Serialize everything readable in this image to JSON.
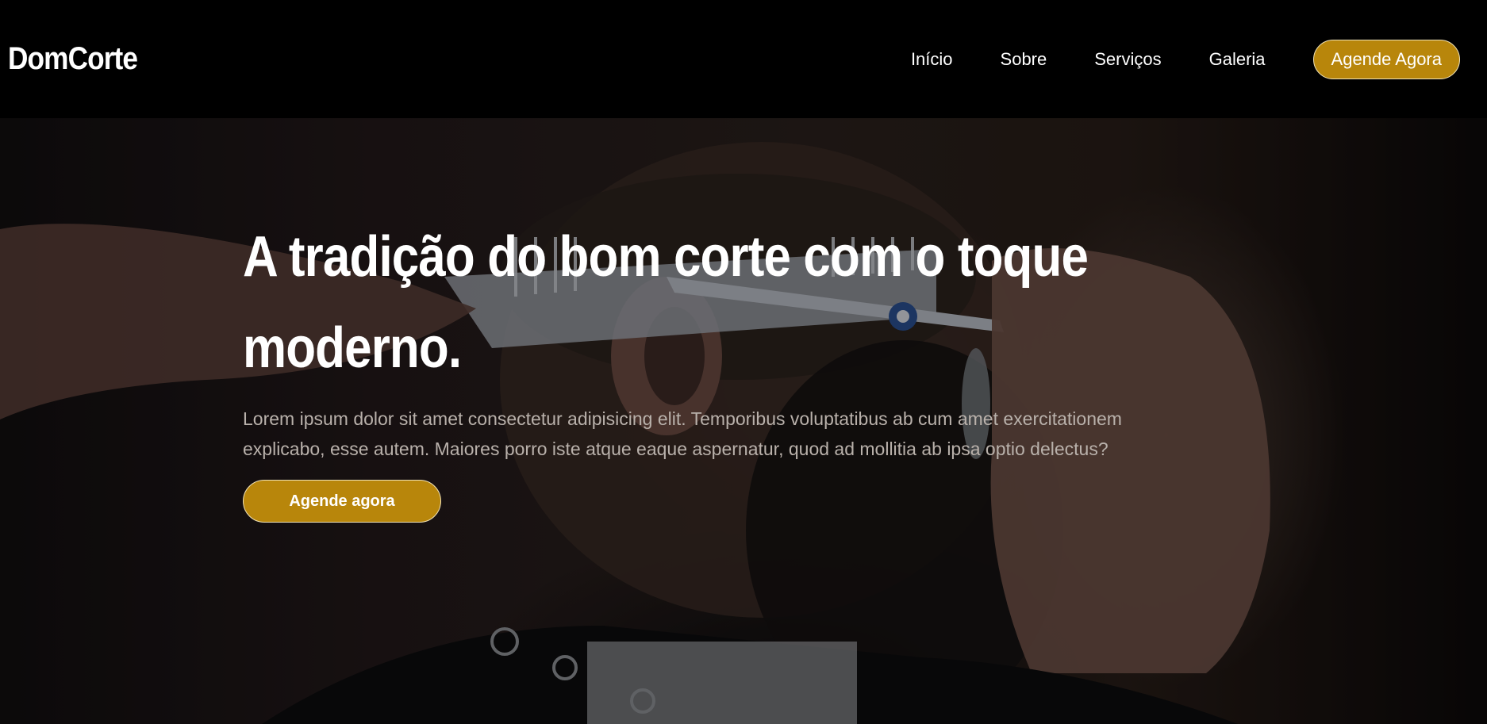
{
  "brand": {
    "name": "DomCorte"
  },
  "nav": {
    "items": [
      {
        "label": "Início"
      },
      {
        "label": "Sobre"
      },
      {
        "label": "Serviços"
      },
      {
        "label": "Galeria"
      }
    ],
    "cta_label": "Agende Agora"
  },
  "hero": {
    "title": "A tradição do bom corte com o toque moderno.",
    "text": "Lorem ipsum dolor sit amet consectetur adipisicing elit. Temporibus voluptatibus ab cum amet exercitationem explicabo, esse autem. Maiores porro iste atque eaque aspernatur, quod ad mollitia ab ipsa optio delectus?",
    "button_label": "Agende agora"
  },
  "colors": {
    "accent": "#b8860b",
    "header_bg": "#000000",
    "text": "#ffffff"
  }
}
